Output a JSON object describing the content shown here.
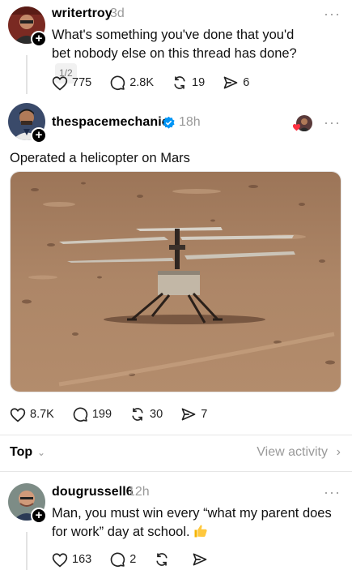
{
  "post1": {
    "username": "writertroy",
    "time": "3d",
    "text": "What's something you've done that you'd bet nobody else on this thread has done?",
    "counter": "1/2",
    "likes": "775",
    "comments": "2.8K",
    "reposts": "19",
    "shares": "6"
  },
  "post2": {
    "username": "thespacemechanic",
    "time": "18h",
    "text": "Operated a helicopter on Mars",
    "likes": "8.7K",
    "comments": "199",
    "reposts": "30",
    "shares": "7"
  },
  "sort_bar": {
    "label": "Top",
    "view_activity": "View activity"
  },
  "post3": {
    "username": "dougrussell6",
    "time": "12h",
    "text": "Man, you must win every “what my parent does for work” day at school.",
    "likes": "163",
    "comments": "2"
  },
  "icons": {
    "like": "heart-icon",
    "comment": "comment-icon",
    "repost": "repost-icon",
    "share": "send-icon",
    "more": "more-icon",
    "verified": "verified-badge-icon"
  },
  "colors": {
    "verified_blue": "#0095f6",
    "muted_gray": "#9a9a9a",
    "mars_ground": "#a98262"
  }
}
